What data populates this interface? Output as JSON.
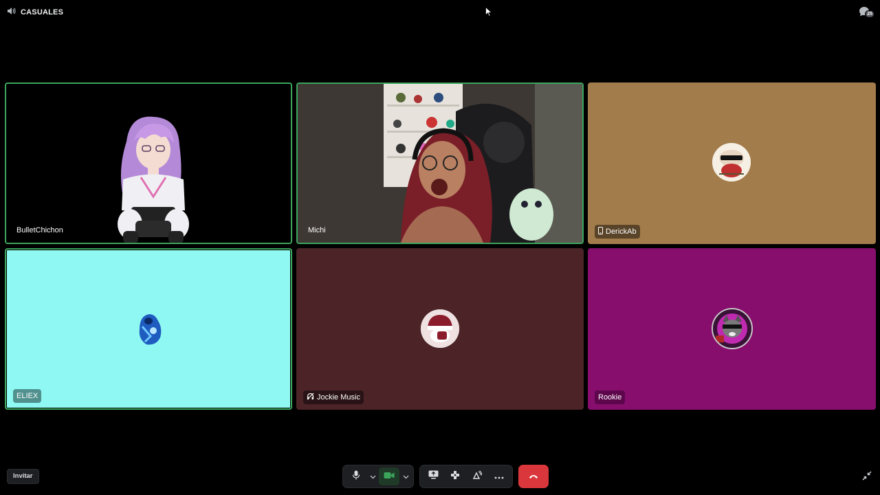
{
  "header": {
    "channel_icon": "speaker-icon",
    "channel_name": "CASUALES",
    "chat_icon": "chat-bubble-icon",
    "chat_badge": "25"
  },
  "tiles": [
    {
      "name": "BulletChichon",
      "type": "video",
      "speaking": true,
      "background": "#000000"
    },
    {
      "name": "Michi",
      "type": "video",
      "speaking": true,
      "background": "#3a3631"
    },
    {
      "name": "DerickAb",
      "type": "avatar",
      "speaking": false,
      "background": "#a27c4b",
      "badge_icon": "mobile-phone-icon"
    },
    {
      "name": "ELIEX",
      "type": "avatar",
      "speaking": true,
      "background": "#8ff8f2"
    },
    {
      "name": "Jockie Music",
      "type": "avatar",
      "speaking": false,
      "background": "#4c2428",
      "badge_icon": "headphones-muted-icon"
    },
    {
      "name": "Rookie",
      "type": "avatar",
      "speaking": false,
      "background": "#870e6d"
    }
  ],
  "footer": {
    "invite_label": "Invitar",
    "controls": [
      {
        "icon": "microphone-icon"
      },
      {
        "icon": "chevron-down-icon"
      },
      {
        "icon": "camera-icon",
        "active": true
      },
      {
        "icon": "chevron-down-icon"
      },
      {
        "icon": "screen-share-icon"
      },
      {
        "icon": "activities-icon"
      },
      {
        "icon": "soundboard-icon"
      },
      {
        "icon": "more-icon"
      },
      {
        "icon": "hang-up-icon"
      }
    ],
    "fullscreen_icon": "exit-fullscreen-icon"
  },
  "colors": {
    "speaking_border": "#3ba55c",
    "hangup": "#da373c",
    "camera_active": "#3ba55c"
  }
}
